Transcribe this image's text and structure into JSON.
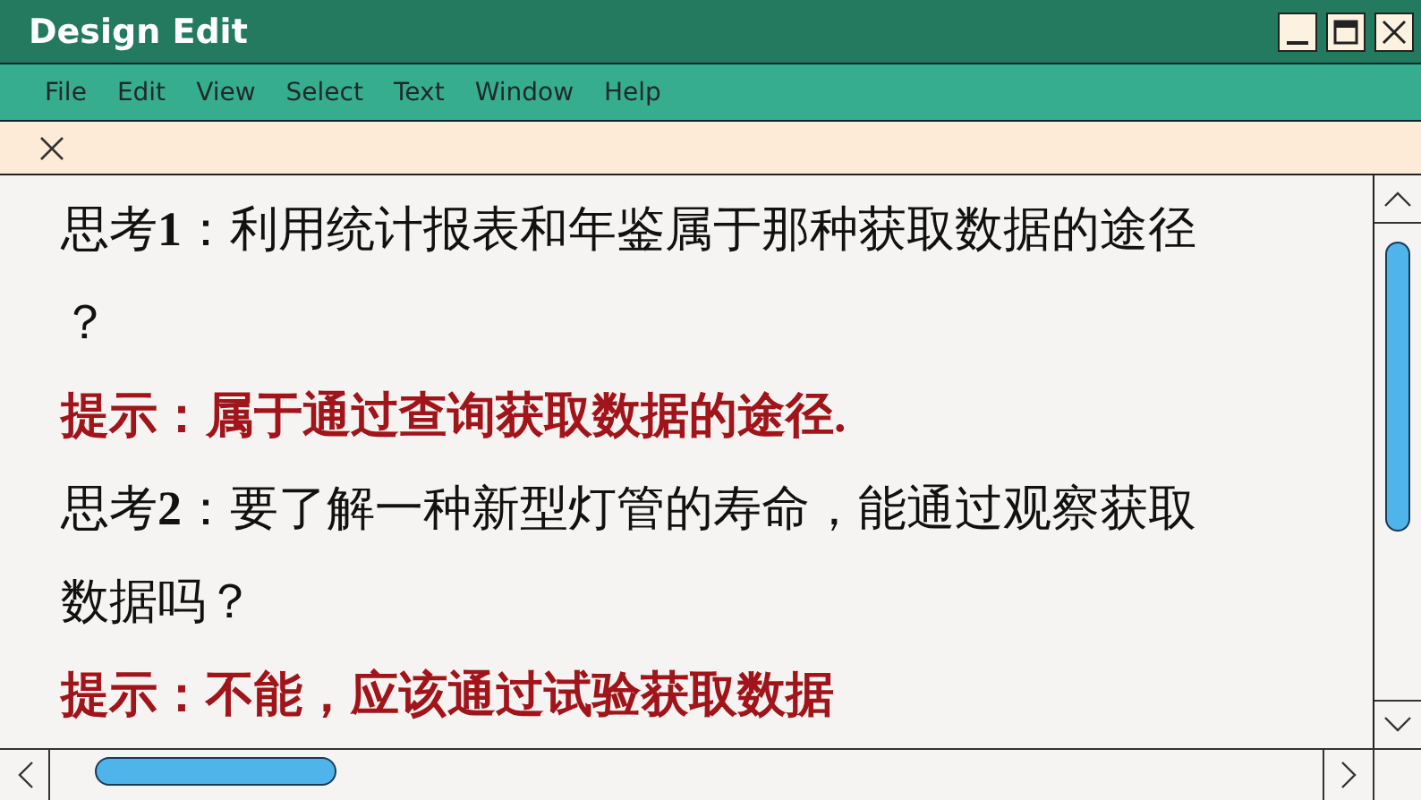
{
  "window": {
    "title": "Design Edit"
  },
  "menu": [
    "File",
    "Edit",
    "View",
    "Select",
    "Text",
    "Window",
    "Help"
  ],
  "paragraphs": [
    {
      "kind": "question",
      "text": "思考**1**：利用统计报表和年鉴属于那种获取数据的途径？"
    },
    {
      "kind": "hint",
      "text": "提示：属于通过查询获取数据的途径."
    },
    {
      "kind": "question",
      "text": "思考**2**：要了解一种新型灯管的寿命，能通过观察获取数据吗？"
    },
    {
      "kind": "hint",
      "text": "提示：不能，应该通过试验获取数据"
    }
  ]
}
